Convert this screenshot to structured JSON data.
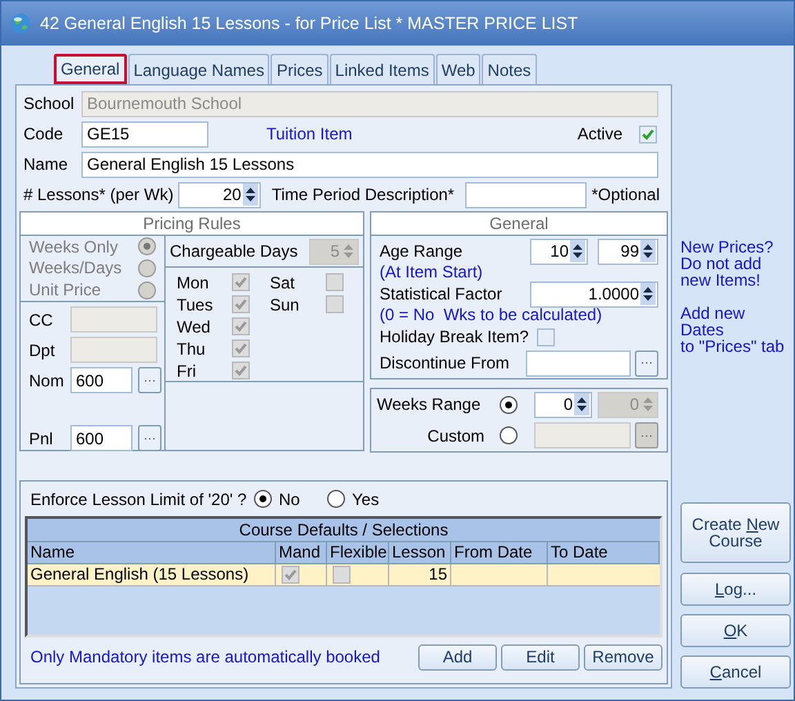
{
  "window": {
    "title": "42 General English 15 Lessons - for Price List * MASTER PRICE LIST"
  },
  "tabs": [
    {
      "label": "General",
      "selected": true
    },
    {
      "label": "Language Names",
      "selected": false
    },
    {
      "label": "Prices",
      "selected": false
    },
    {
      "label": "Linked Items",
      "selected": false
    },
    {
      "label": "Web",
      "selected": false
    },
    {
      "label": "Notes",
      "selected": false
    }
  ],
  "form": {
    "school": {
      "label": "School",
      "value": "Bournemouth School"
    },
    "code": {
      "label": "Code",
      "value": "GE15"
    },
    "item_type": "Tuition Item",
    "active": {
      "label": "Active",
      "checked": true
    },
    "name": {
      "label": "Name",
      "value": "General English 15 Lessons"
    },
    "lessons": {
      "label": "# Lessons* (per Wk)",
      "value": "20"
    },
    "time_period": {
      "label": "Time Period Description*",
      "note": "*Optional"
    }
  },
  "pricing_rules": {
    "title": "Pricing Rules",
    "options": [
      {
        "label": "Weeks Only",
        "selected": true
      },
      {
        "label": "Weeks/Days",
        "selected": false
      },
      {
        "label": "Unit Price",
        "selected": false
      }
    ],
    "chargeable_days": {
      "label": "Chargeable Days",
      "value": "5"
    },
    "days": [
      {
        "label": "Mon",
        "checked": true
      },
      {
        "label": "Sat",
        "checked": false
      },
      {
        "label": "Tues",
        "checked": true
      },
      {
        "label": "Sun",
        "checked": false
      },
      {
        "label": "Wed",
        "checked": true
      },
      {
        "label": "Thu",
        "checked": true
      },
      {
        "label": "Fri",
        "checked": true
      }
    ],
    "accounts": [
      {
        "label": "CC",
        "kind": "readonly"
      },
      {
        "label": "Dpt",
        "kind": "readonly"
      },
      {
        "label": "Nom",
        "kind": "lookup",
        "value": "600"
      },
      {
        "label": "Pnl",
        "kind": "lookup",
        "value": "600"
      }
    ]
  },
  "general": {
    "title": "General",
    "age_range": {
      "label": "Age Range",
      "from": "10",
      "to": "99",
      "note": "(At Item Start)"
    },
    "statistical_factor": {
      "label": "Statistical Factor",
      "value": "1.0000",
      "note": "(0 = No  Wks to be calculated)"
    },
    "holiday_break": {
      "label": "Holiday Break Item?",
      "checked": false
    },
    "discontinue_from": {
      "label": "Discontinue From"
    }
  },
  "range": {
    "options": [
      {
        "label": "Weeks Range",
        "selected": true,
        "from": "0",
        "to": "0"
      },
      {
        "label": "Custom",
        "selected": false
      }
    ]
  },
  "enforce": {
    "label": "Enforce Lesson Limit of '20' ?",
    "options": [
      {
        "label": "No",
        "selected": true
      },
      {
        "label": "Yes",
        "selected": false
      }
    ]
  },
  "course_defaults": {
    "title": "Course Defaults / Selections",
    "columns": [
      "Name",
      "Mand",
      "Flexible",
      "Lesson",
      "From Date",
      "To Date"
    ],
    "rows": [
      {
        "name": "General English (15 Lessons)",
        "mandatory": true,
        "flexible": false,
        "lesson": "15",
        "selected": true
      }
    ],
    "note": "Only Mandatory items are automatically booked",
    "buttons": [
      "Add",
      "Edit",
      "Remove"
    ]
  },
  "side_notes": [
    "New Prices?\nDo not add\nnew Items!",
    "Add new Dates\nto \"Prices\" tab"
  ],
  "actions": [
    {
      "label": "Create New\nCourse"
    },
    {
      "label": "Log..."
    },
    {
      "label": "OK"
    },
    {
      "label": "Cancel"
    }
  ]
}
